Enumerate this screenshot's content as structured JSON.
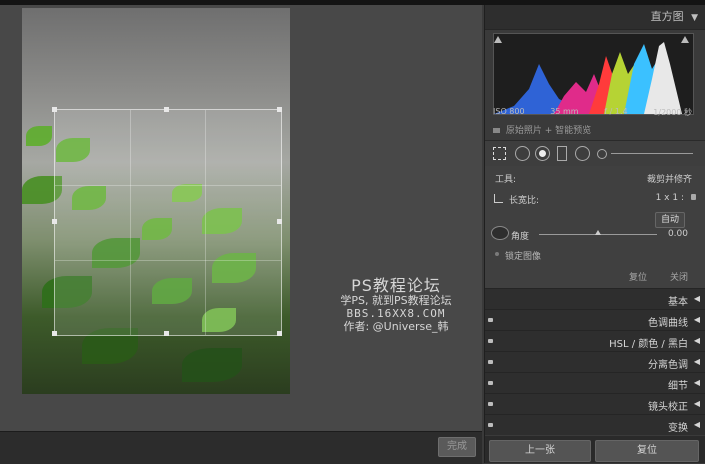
{
  "histogram": {
    "title": "直方图",
    "iso": "ISO 800",
    "focal": "35 mm",
    "aperture": "f / 1.4",
    "shutter": "1/2000 秒",
    "original_label": "原始照片 + 智能预览"
  },
  "crop_panel": {
    "tool_label": "工具:",
    "tool_value": "裁剪并修齐",
    "aspect_label": "长宽比:",
    "aspect_value": "1 x 1 :",
    "auto_label": "自动",
    "angle_label": "角度",
    "angle_value": "0.00",
    "lock_label": "锁定图像",
    "reset_label": "复位",
    "close_label": "关闭"
  },
  "sections": [
    {
      "label": "基本"
    },
    {
      "label": "色调曲线"
    },
    {
      "label": "HSL / 颜色 / 黑白"
    },
    {
      "label": "分离色调"
    },
    {
      "label": "细节"
    },
    {
      "label": "镜头校正"
    },
    {
      "label": "变换"
    }
  ],
  "buttons": {
    "previous": "上一张",
    "reset": "复位",
    "done": "完成"
  },
  "watermark": {
    "line1": "PS教程论坛",
    "line2": "学PS, 就到PS教程论坛",
    "line3": "BBS.16XX8.COM",
    "line4": "作者: @Universe_韩"
  }
}
